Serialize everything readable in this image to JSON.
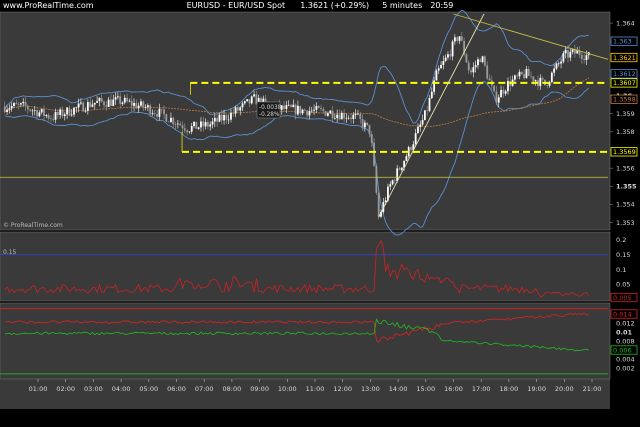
{
  "header": {
    "logo": "www.ProRealTime.com",
    "symbol": "EURUSD",
    "description": "EUR/USD Spot",
    "price_change": "1.3621 (+0.29%)",
    "interval": "5 minutes",
    "time": "20:59"
  },
  "watermark": "© ProRealTime.com",
  "colors": {
    "background": "#000000",
    "panel": "#3a3a3a",
    "candle_up": "#ffffff",
    "candle_down": "#9a9a9a",
    "bollinger": "#5a8fd0",
    "moving_average": "#c07a3a",
    "horizontal_levels": "#ffff00",
    "trendline": "#e8e0b0",
    "indicator1": "#cc2222",
    "indicator2_red": "#dd2222",
    "indicator2_green": "#22bb22"
  },
  "price_panel": {
    "y_ticks": [
      "1.364",
      "1.363",
      "1.362",
      "1.361",
      "1.36",
      "1.359",
      "1.358",
      "1.357",
      "1.356",
      "1.355",
      "1.354",
      "1.353"
    ],
    "y_range": [
      1.3527,
      1.3645
    ],
    "annotation": [
      "-0.0038",
      "-0.28%"
    ],
    "price_tags": [
      {
        "label": "1.363",
        "value": 1.363,
        "color": "#5a8fd0"
      },
      {
        "label": "1.3621",
        "value": 1.3621,
        "color": "#ffcc00"
      },
      {
        "label": "1.3612",
        "value": 1.3612,
        "color": "#5a8fd0"
      },
      {
        "label": "1.3607",
        "value": 1.3607,
        "color": "#ffff00"
      },
      {
        "label": "1.3598",
        "value": 1.3598,
        "color": "#c07a3a"
      },
      {
        "label": "1.3569",
        "value": 1.3569,
        "color": "#ffff00"
      }
    ],
    "levels": [
      {
        "value": 1.3607,
        "style": "dashed"
      },
      {
        "value": 1.3569,
        "style": "dashed"
      },
      {
        "value": 1.3555,
        "style": "solid"
      }
    ]
  },
  "indicator1": {
    "y_ticks": [
      "0.2",
      "0.15",
      "0.1",
      "0.05"
    ],
    "y_range": [
      0,
      0.22
    ],
    "label": "0.15",
    "reference": 0.15,
    "value_tag": "0.005"
  },
  "indicator2": {
    "y_ticks": [
      "0.014",
      "0.012",
      "0.01",
      "0.008",
      "0.006",
      "0.004",
      "0.002"
    ],
    "y_range": [
      0,
      0.016
    ],
    "value_tags": [
      {
        "label": "0.014",
        "value": 0.014,
        "color": "#dd2222"
      },
      {
        "label": "0.006",
        "value": 0.006,
        "color": "#22bb22"
      }
    ]
  },
  "x_axis": {
    "labels": [
      "01:00",
      "02:00",
      "03:00",
      "04:00",
      "05:00",
      "06:00",
      "07:00",
      "08:00",
      "09:00",
      "10:00",
      "11:00",
      "12:00",
      "13:00",
      "14:00",
      "15:00",
      "16:00",
      "17:00",
      "18:00",
      "19:00",
      "20:00",
      "21:00"
    ]
  }
}
